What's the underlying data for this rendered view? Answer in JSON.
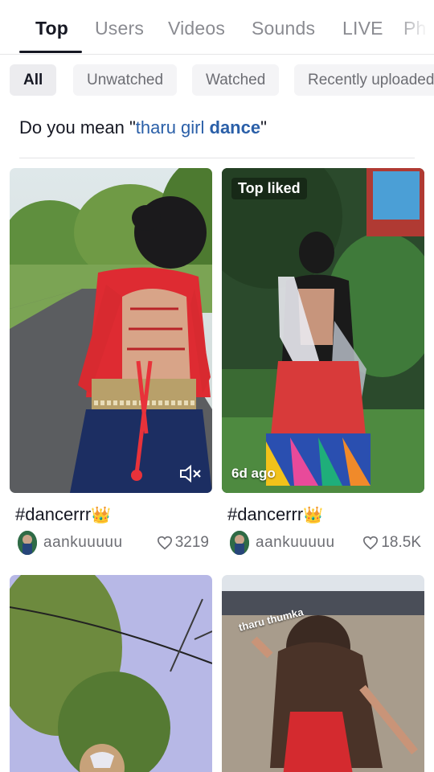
{
  "tabs": [
    {
      "label": "Top",
      "active": true
    },
    {
      "label": "Users"
    },
    {
      "label": "Videos"
    },
    {
      "label": "Sounds"
    },
    {
      "label": "LIVE"
    },
    {
      "label": "Ph"
    }
  ],
  "filters": [
    {
      "label": "All",
      "active": true
    },
    {
      "label": "Unwatched"
    },
    {
      "label": "Watched"
    },
    {
      "label": "Recently uploaded"
    }
  ],
  "suggestion": {
    "prefix": "Do you mean \"",
    "query_plain": "tharu girl ",
    "query_bold": "dance",
    "suffix": "\""
  },
  "results": [
    {
      "title": "#dancerrr",
      "emoji": "👑",
      "author": "aankuuuuu",
      "likes": "3219",
      "muted": true
    },
    {
      "title": "#dancerrr",
      "emoji": "👑",
      "author": "aankuuuuu",
      "likes": "18.5K",
      "badge": "Top liked",
      "date_label": "6d ago"
    },
    {
      "title": "",
      "author": "",
      "likes": ""
    },
    {
      "title": "",
      "author": "",
      "likes": "",
      "sticker": "tharu thumka"
    }
  ],
  "colors": {
    "text_primary": "#161823",
    "text_secondary": "#6c6d73",
    "link_blue": "#2a5fa8",
    "chip_bg": "#f4f4f6"
  }
}
